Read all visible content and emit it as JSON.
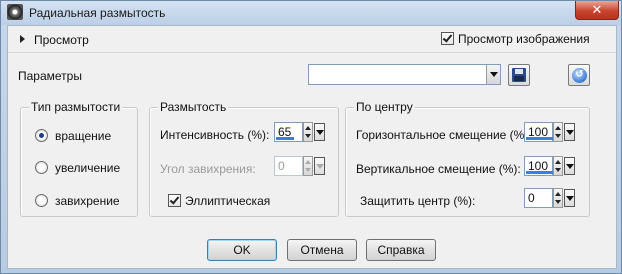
{
  "window": {
    "title": "Радиальная размытость",
    "close_label": "✕"
  },
  "preview": {
    "label": "Просмотр",
    "image_preview_label": "Просмотр изображения",
    "image_preview_checked": true
  },
  "presets": {
    "label": "Параметры",
    "value": ""
  },
  "blur_type": {
    "title": "Тип размытости",
    "options": [
      {
        "label": "вращение",
        "selected": true
      },
      {
        "label": "увеличение",
        "selected": false
      },
      {
        "label": "завихрение",
        "selected": false
      }
    ]
  },
  "blur": {
    "title": "Размытость",
    "intensity": {
      "label": "Интенсивность (%):",
      "value": "65",
      "level": 0.65
    },
    "twist": {
      "label": "Угол завихрения:",
      "value": "0",
      "enabled": false,
      "level": 0.0
    },
    "elliptical": {
      "label": "Эллиптическая",
      "checked": true
    }
  },
  "center": {
    "title": "По центру",
    "h_offset": {
      "label": "Горизонтальное смещение (%):",
      "value": "100",
      "level": 1.0
    },
    "v_offset": {
      "label": "Вертикальное смещение (%):",
      "value": "100",
      "level": 1.0
    },
    "protect": {
      "label": "Защитить центр (%):",
      "value": "0"
    }
  },
  "buttons": {
    "ok": "OK",
    "cancel": "Отмена",
    "help": "Справка"
  },
  "icons": {
    "app": "radial-blur-icon",
    "expander": "expand-triangle-icon",
    "save": "floppy-disk-icon",
    "reset": "reset-icon"
  },
  "colors": {
    "accent": "#3b7fd6",
    "title_bar": "#c7d8ec",
    "close": "#c8452e"
  }
}
